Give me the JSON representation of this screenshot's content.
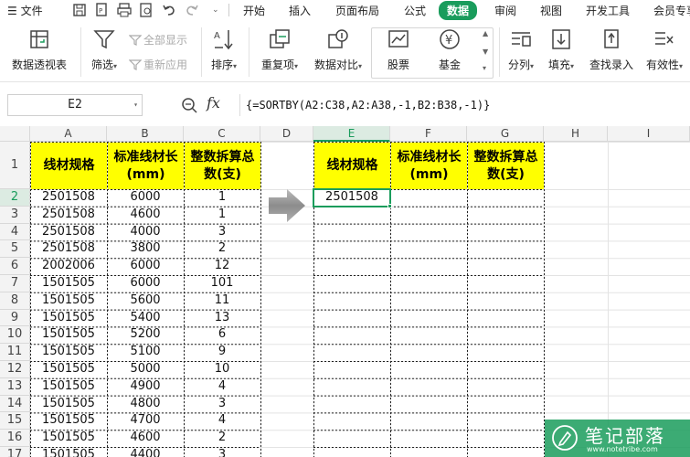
{
  "menu": {
    "file_label": "文件",
    "tabs": [
      {
        "label": "开始",
        "active": false
      },
      {
        "label": "插入",
        "active": false
      },
      {
        "label": "页面布局",
        "active": false
      },
      {
        "label": "公式",
        "active": false
      },
      {
        "label": "数据",
        "active": true
      },
      {
        "label": "审阅",
        "active": false
      },
      {
        "label": "视图",
        "active": false
      },
      {
        "label": "开发工具",
        "active": false
      },
      {
        "label": "会员专享",
        "active": false
      }
    ]
  },
  "ribbon": {
    "pivot": "数据透视表",
    "filter": "筛选",
    "show_all": "全部显示",
    "reapply": "重新应用",
    "sort": "排序",
    "duplicates": "重复项",
    "compare": "数据对比",
    "stock": "股票",
    "fund": "基金",
    "split": "分列",
    "fill": "填充",
    "lookup": "查找录入",
    "validity": "有效性"
  },
  "formula_bar": {
    "name_box": "E2",
    "fx": "fx",
    "formula": "{=SORTBY(A2:C38,A2:A38,-1,B2:B38,-1)}"
  },
  "grid": {
    "columns": [
      "A",
      "B",
      "C",
      "D",
      "E",
      "F",
      "G",
      "H",
      "I"
    ],
    "active_column": "E",
    "row_numbers": [
      "1",
      "2",
      "3",
      "4",
      "5",
      "6",
      "7",
      "8",
      "9",
      "10",
      "11",
      "12",
      "13",
      "14",
      "15",
      "16",
      "17"
    ],
    "active_row": "2",
    "headers_left": [
      "线材规格",
      "标准线材长(mm)",
      "整数拆算总数(支)"
    ],
    "headers_right": [
      "线材规格",
      "标准线材长(mm)",
      "整数拆算总数(支)"
    ],
    "rows": [
      [
        "2501508",
        "6000",
        "1"
      ],
      [
        "2501508",
        "4600",
        "1"
      ],
      [
        "2501508",
        "4000",
        "3"
      ],
      [
        "2501508",
        "3800",
        "2"
      ],
      [
        "2002006",
        "6000",
        "12"
      ],
      [
        "1501505",
        "6000",
        "101"
      ],
      [
        "1501505",
        "5600",
        "11"
      ],
      [
        "1501505",
        "5400",
        "13"
      ],
      [
        "1501505",
        "5200",
        "6"
      ],
      [
        "1501505",
        "5100",
        "9"
      ],
      [
        "1501505",
        "5000",
        "10"
      ],
      [
        "1501505",
        "4900",
        "4"
      ],
      [
        "1501505",
        "4800",
        "3"
      ],
      [
        "1501505",
        "4700",
        "4"
      ],
      [
        "1501505",
        "4600",
        "2"
      ],
      [
        "1501505",
        "4400",
        "3"
      ]
    ],
    "result_first": "2501508"
  },
  "watermark": {
    "text": "笔记部落",
    "url": "www.notetribe.com"
  },
  "colors": {
    "accent": "#1a9c5c",
    "header_fill": "#ffff00",
    "selection_tint": "#dcebe2"
  }
}
